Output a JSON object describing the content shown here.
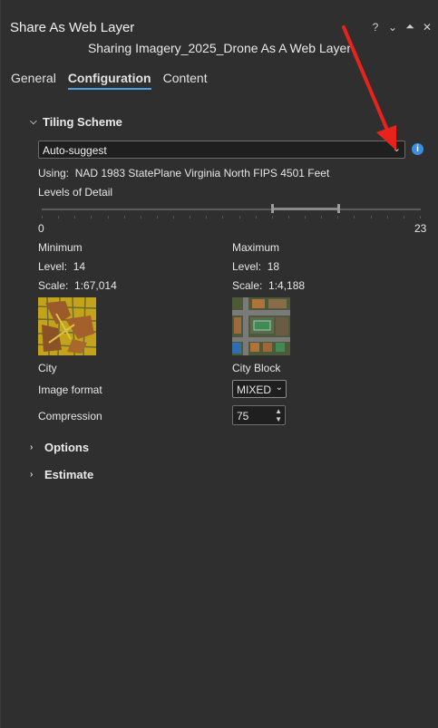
{
  "window": {
    "title": "Share As Web Layer",
    "subtitle": "Sharing Imagery_2025_Drone As A Web Layer"
  },
  "icons": {
    "help": "help-icon",
    "dropdown": "chevron-down-icon",
    "pin": "pin-icon",
    "close": "close-icon",
    "info": "info-icon"
  },
  "tabs": [
    {
      "label": "General",
      "active": false
    },
    {
      "label": "Configuration",
      "active": true
    },
    {
      "label": "Content",
      "active": false
    }
  ],
  "tiling": {
    "header": "Tiling Scheme",
    "scheme": "Auto-suggest",
    "using_label": "Using:",
    "using_value": "NAD 1983 StatePlane Virginia North FIPS 4501 Feet",
    "levels_label": "Levels of Detail",
    "slider_min": "0",
    "slider_max": "23",
    "selected_min_level": 14,
    "selected_max_level": 18
  },
  "minimum": {
    "header": "Minimum",
    "level_label": "Level:",
    "level": "14",
    "scale_label": "Scale:",
    "scale": "1:67,014",
    "caption": "City"
  },
  "maximum": {
    "header": "Maximum",
    "level_label": "Level:",
    "level": "18",
    "scale_label": "Scale:",
    "scale": "1:4,188",
    "caption": "City Block"
  },
  "image_format": {
    "label": "Image format",
    "value": "MIXED"
  },
  "compression": {
    "label": "Compression",
    "value": "75"
  },
  "sections": {
    "options": "Options",
    "estimate": "Estimate"
  },
  "colors": {
    "accent": "#4aa3e6",
    "annotation_arrow": "#e8231c",
    "background": "#2f2f2f"
  }
}
